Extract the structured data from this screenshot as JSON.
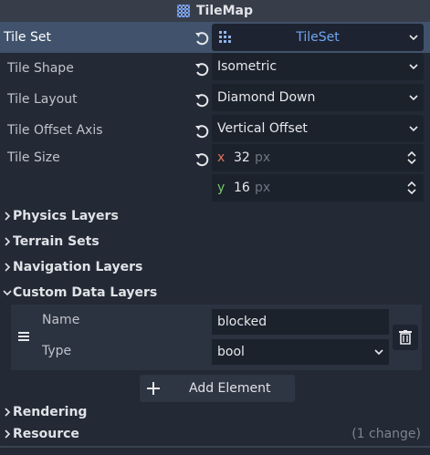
{
  "header": {
    "title": "TileMap",
    "icon": "tilemap-grid-icon"
  },
  "tile_set": {
    "label": "Tile Set",
    "value": "TileSet",
    "icon": "tileset-resource-icon"
  },
  "properties": [
    {
      "label": "Tile Shape",
      "value": "Isometric"
    },
    {
      "label": "Tile Layout",
      "value": "Diamond Down"
    },
    {
      "label": "Tile Offset Axis",
      "value": "Vertical Offset"
    }
  ],
  "tile_size": {
    "label": "Tile Size",
    "x_axis": "x",
    "x": "32",
    "y_axis": "y",
    "y": "16",
    "unit": "px"
  },
  "sections": {
    "physics": "Physics Layers",
    "terrain": "Terrain Sets",
    "navigation": "Navigation Layers",
    "custom_data": "Custom Data Layers",
    "rendering": "Rendering",
    "resource": "Resource",
    "resource_hint": "(1 change)"
  },
  "custom_data_element": {
    "name_label": "Name",
    "name_value": "blocked",
    "type_label": "Type",
    "type_value": "bool"
  },
  "add_element_label": "Add Element",
  "colors": {
    "accent": "#6ea6f2",
    "selected_row": "#41536c",
    "x_axis": "#e0745a",
    "y_axis": "#79c46a"
  }
}
